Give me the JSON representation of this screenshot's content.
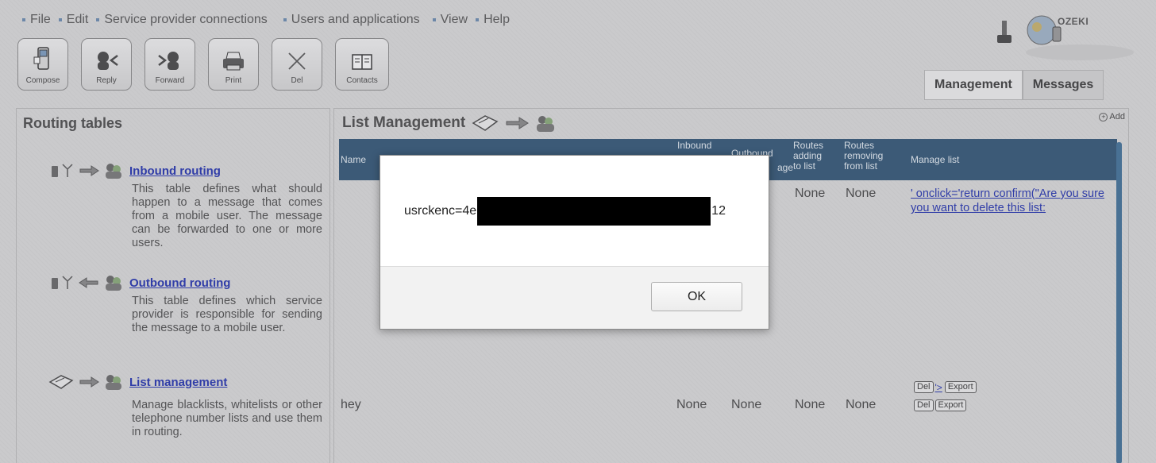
{
  "menu": [
    {
      "label": "File"
    },
    {
      "label": "Edit"
    },
    {
      "label": "Service provider connections"
    },
    {
      "label": "Users and applications"
    },
    {
      "label": "View"
    },
    {
      "label": "Help"
    }
  ],
  "toolbar": {
    "compose": "Compose",
    "reply": "Reply",
    "forward": "Forward",
    "print": "Print",
    "del": "Del",
    "contacts": "Contacts"
  },
  "logo": {
    "text": "OZEKI"
  },
  "tabs": {
    "management": "Management",
    "messages": "Messages"
  },
  "left_panel": {
    "title": "Routing tables",
    "items": [
      {
        "link": "Inbound routing",
        "desc": "This table defines what should happen to a message that comes from a mobile user. The message can be forwarded to one or more users."
      },
      {
        "link": "Outbound routing",
        "desc": "This table defines which service provider is responsible for sending the message to a mobile user."
      },
      {
        "link": "List management",
        "desc": "Manage blacklists, whitelists or other telephone number lists and use them in routing."
      }
    ]
  },
  "right_panel": {
    "title": "List Management",
    "add_label": "Add",
    "columns": {
      "name": "Name",
      "inbound": "Inbound",
      "outbound_1": "Outbound",
      "outbound_2": "age",
      "routes_adding": [
        "Routes",
        "adding",
        "to list"
      ],
      "routes_removing": [
        "Routes",
        "removing",
        "from list"
      ],
      "manage": "Manage list"
    },
    "rows": [
      {
        "name": "",
        "inbound": "",
        "outbound": "",
        "adding": "None",
        "removing": "None",
        "manage_text": "' onclick='return confirm(\"Are you sure you want to delete this list:"
      },
      {
        "name": "hey",
        "inbound": "None",
        "outbound": "None",
        "adding": "None",
        "removing": "None"
      }
    ],
    "row_btns": {
      "del": "Del",
      "export": "Export",
      "gt_link": "'>"
    }
  },
  "dialog": {
    "message_prefix": "usrckenc=4e",
    "message_suffix": "12",
    "ok_label": "OK"
  }
}
